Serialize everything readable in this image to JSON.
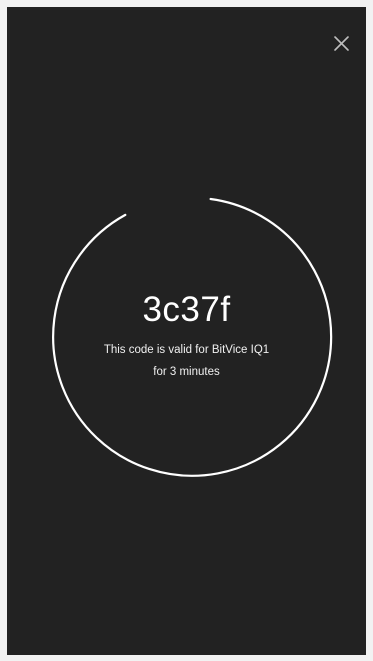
{
  "screen": {
    "background_color": "#222222",
    "close_icon": "close-icon",
    "code": "3c37f",
    "message_line1": "This code is valid for BitVice IQ1",
    "message_line2": "for 3 minutes",
    "countdown_ring_color": "#ffffff"
  }
}
